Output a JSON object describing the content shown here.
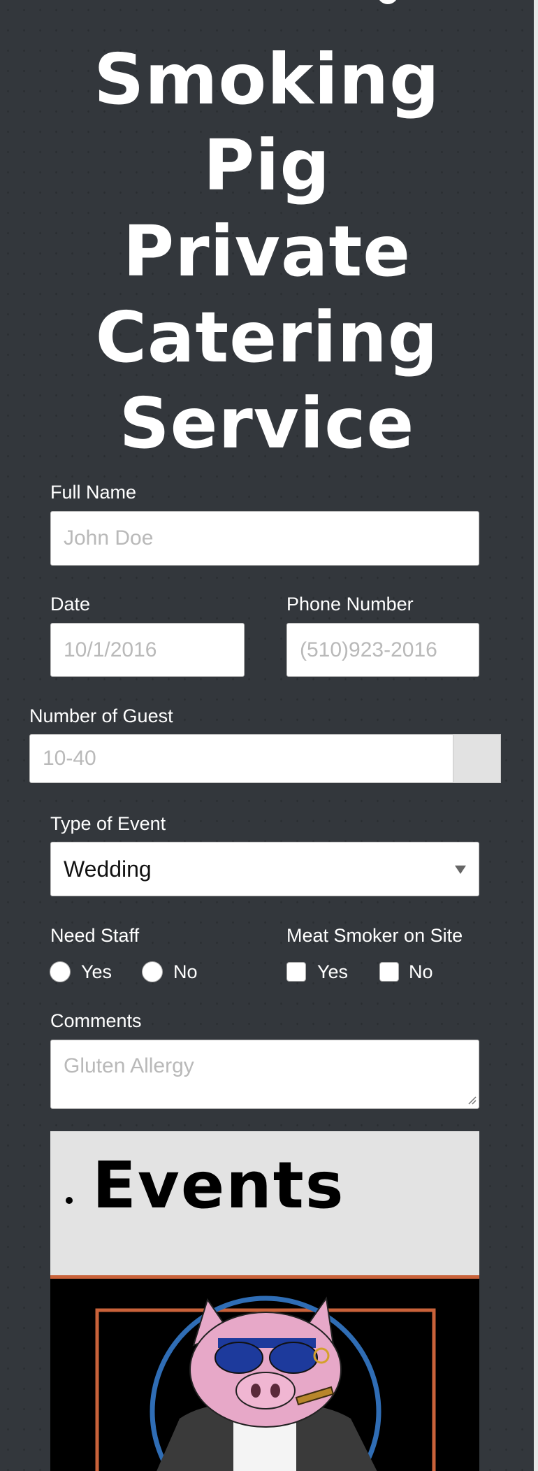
{
  "page": {
    "title_lines": [
      "Smoking",
      "Pig",
      "Private",
      "Catering",
      "Service"
    ]
  },
  "form": {
    "full_name": {
      "label": "Full Name",
      "placeholder": "John Doe",
      "value": ""
    },
    "date": {
      "label": "Date",
      "placeholder": "10/1/2016",
      "value": ""
    },
    "phone": {
      "label": "Phone Number",
      "placeholder": "(510)923-2016",
      "value": ""
    },
    "guests": {
      "label": "Number of Guest",
      "placeholder": "10-40",
      "value": ""
    },
    "event_type": {
      "label": "Type of Event",
      "selected": "Wedding"
    },
    "need_staff": {
      "label": "Need Staff",
      "options": [
        "Yes",
        "No"
      ]
    },
    "meat_smoker": {
      "label": "Meat Smoker on Site",
      "options": [
        "Yes",
        "No"
      ]
    },
    "comments": {
      "label": "Comments",
      "placeholder": "Gluten Allergy",
      "value": ""
    }
  },
  "events": {
    "heading": "Events",
    "logo_icon": "smoking-pig-mascot"
  },
  "colors": {
    "background": "#33373c",
    "text": "#ffffff",
    "events_panel": "#e3e3e3",
    "logo_border": "#c9623a",
    "logo_circle": "#2f6db5"
  }
}
